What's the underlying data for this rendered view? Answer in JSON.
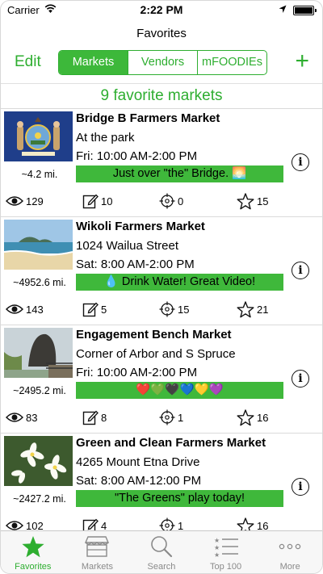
{
  "status_bar": {
    "carrier": "Carrier",
    "time": "2:22 PM"
  },
  "nav": {
    "title": "Favorites",
    "edit_label": "Edit",
    "add_label": "+"
  },
  "segments": [
    "Markets",
    "Vendors",
    "mFOODIEs"
  ],
  "active_segment": "Markets",
  "count_banner": "9 favorite markets",
  "markets": [
    {
      "name": "Bridge B Farmers Market",
      "address": "At the park",
      "hours": "Fri: 10:00 AM-2:00 PM",
      "note": "Just over \"the\" Bridge. 🌅",
      "distance": "~4.2  mi.",
      "views": "129",
      "notes": "10",
      "checkins": "0",
      "stars": "15",
      "thumb": "state-flag"
    },
    {
      "name": "Wikoli Farmers Market",
      "address": "1024 Wailua Street",
      "hours": "Sat: 8:00 AM-2:00 PM",
      "note": "💧 Drink Water! Great Video!",
      "distance": "~4952.6  mi.",
      "views": "143",
      "notes": "5",
      "checkins": "15",
      "stars": "21",
      "thumb": "beach"
    },
    {
      "name": "Engagement Bench Market",
      "address": "Corner of Arbor and S Spruce",
      "hours": "Fri: 10:00 AM-2:00 PM",
      "note": "❤️💚🖤💙💛💜",
      "distance": "~2495.2  mi.",
      "views": "83",
      "notes": "8",
      "checkins": "1",
      "stars": "16",
      "thumb": "haystack-rock"
    },
    {
      "name": "Green and Clean Farmers Market",
      "address": "4265 Mount Etna Drive",
      "hours": "Sat: 8:00 AM-12:00 PM",
      "note": "\"The Greens\" play today!",
      "distance": "~2427.2  mi.",
      "views": "102",
      "notes": "4",
      "checkins": "1",
      "stars": "16",
      "thumb": "plumeria-flowers"
    }
  ],
  "tabs": [
    {
      "label": "Favorites",
      "icon": "star-icon"
    },
    {
      "label": "Markets",
      "icon": "market-stall-icon"
    },
    {
      "label": "Search",
      "icon": "magnifier-icon"
    },
    {
      "label": "Top 100",
      "icon": "ranked-list-icon"
    },
    {
      "label": "More",
      "icon": "more-dots-icon"
    }
  ],
  "active_tab": "Favorites",
  "colors": {
    "accent": "#2eae30",
    "note_bg": "#3fb83b",
    "tab_inactive": "#8a8a8a"
  }
}
